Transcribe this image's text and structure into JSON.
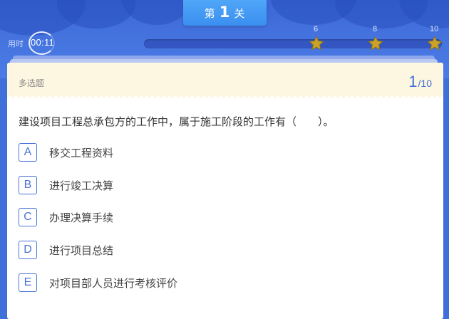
{
  "level": {
    "prefix": "第",
    "number": "1",
    "suffix": "关"
  },
  "timer": {
    "label": "用时",
    "value": "00:11"
  },
  "progress": {
    "milestones": [
      {
        "label": "6",
        "star": "star-icon"
      },
      {
        "label": "8",
        "star": "star-icon"
      },
      {
        "label": "10",
        "star": "star-icon"
      }
    ]
  },
  "question": {
    "type": "多选题",
    "current": "1",
    "total": "/10",
    "text": "建设项目工程总承包方的工作中，属于施工阶段的工作有（　　）。",
    "options": [
      {
        "letter": "A",
        "text": "移交工程资料"
      },
      {
        "letter": "B",
        "text": "进行竣工决算"
      },
      {
        "letter": "C",
        "text": "办理决算手续"
      },
      {
        "letter": "D",
        "text": "进行项目总结"
      },
      {
        "letter": "E",
        "text": "对项目部人员进行考核评价"
      }
    ]
  },
  "colors": {
    "accent": "#3f6fd8",
    "header_bg": "#fdf6e0",
    "tab": "#3b8ff0",
    "star": "#c9a227"
  }
}
